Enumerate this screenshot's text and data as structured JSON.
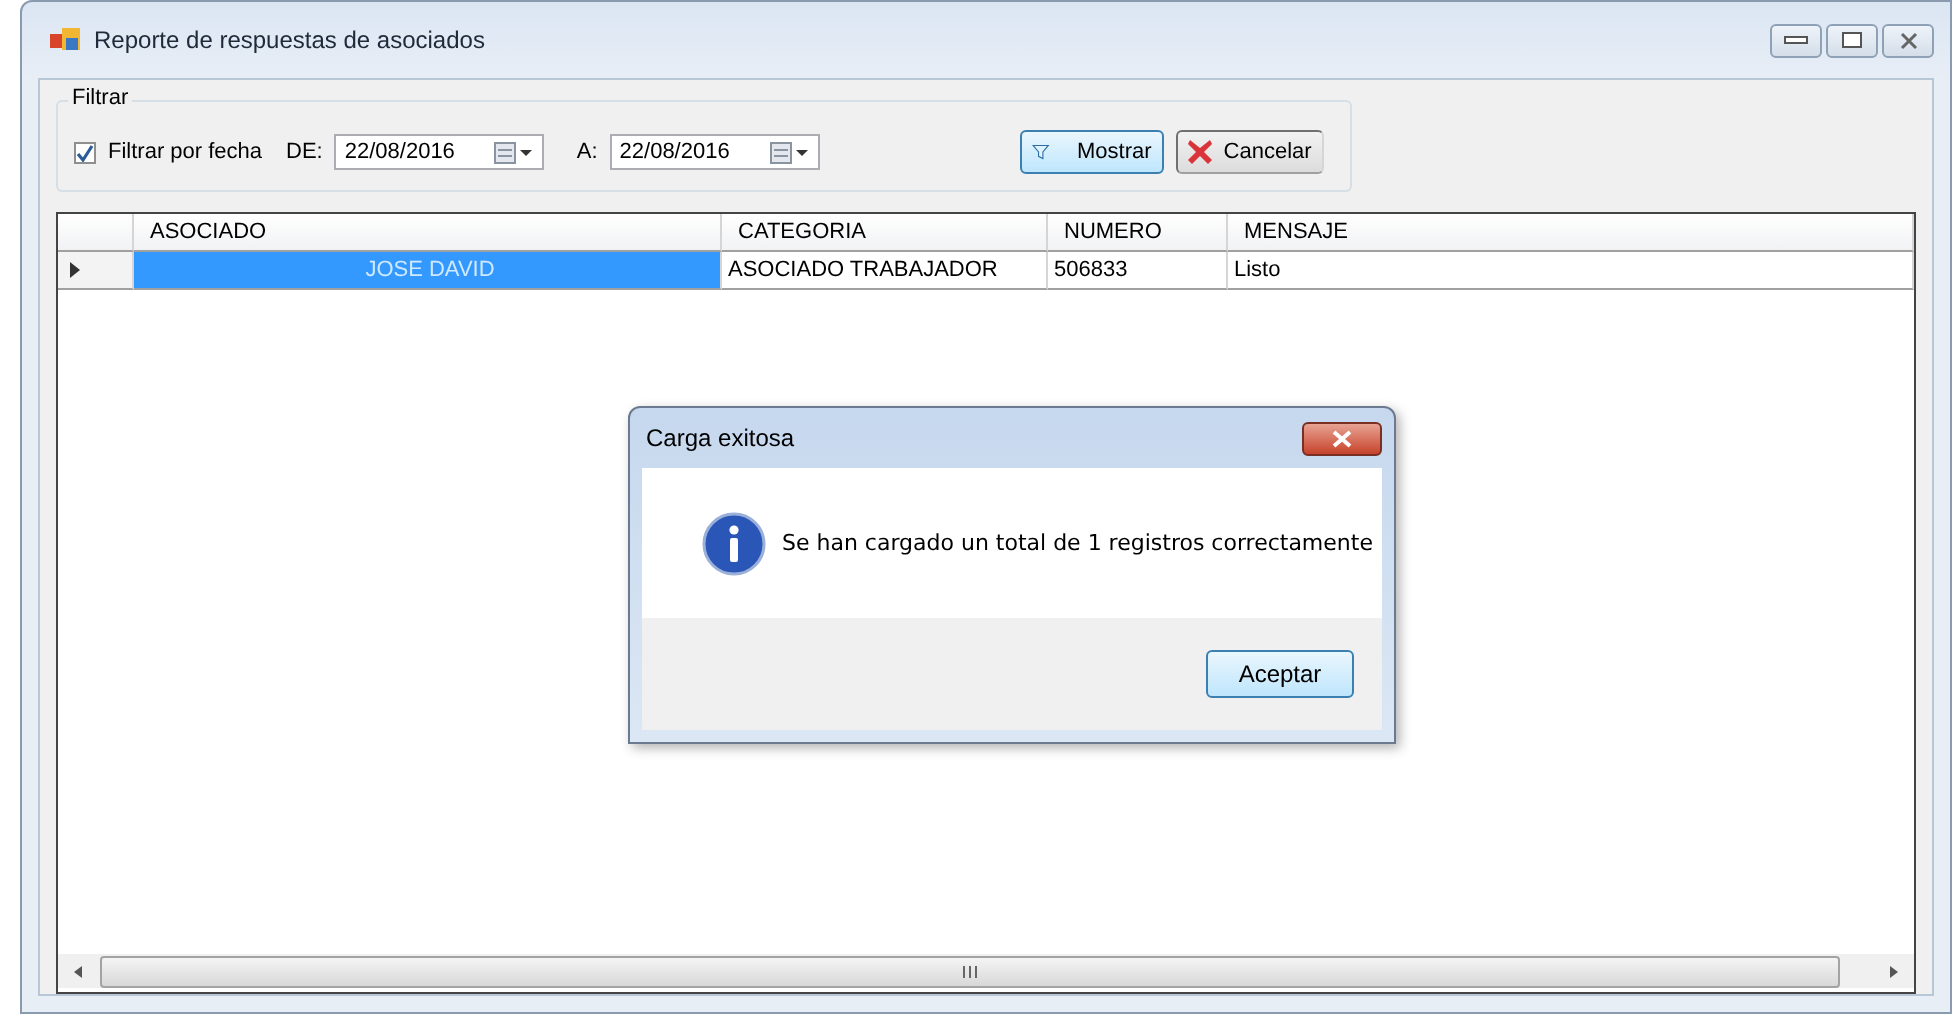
{
  "window": {
    "title": "Reporte de respuestas de asociados"
  },
  "filter": {
    "group_label": "Filtrar",
    "checkbox": {
      "label": "Filtrar por fecha",
      "checked": true
    },
    "from": {
      "label": "DE:",
      "value": "22/08/2016"
    },
    "to": {
      "label": "A:",
      "value": "22/08/2016"
    },
    "buttons": [
      {
        "kind": "filter",
        "label": "Mostrar"
      },
      {
        "kind": "cancel",
        "label": "Cancelar"
      }
    ]
  },
  "table": {
    "columns": [
      "ASOCIADO",
      "CATEGORIA",
      "NUMERO",
      "MENSAJE"
    ],
    "rows": [
      {
        "selected": true,
        "cells": [
          "JOSE DAVID",
          "ASOCIADO TRABAJADOR",
          "506833",
          "Listo"
        ]
      }
    ]
  },
  "dialog": {
    "title": "Carga exitosa",
    "message": "Se han cargado un total de 1 registros correctamente",
    "button": "Aceptar"
  }
}
